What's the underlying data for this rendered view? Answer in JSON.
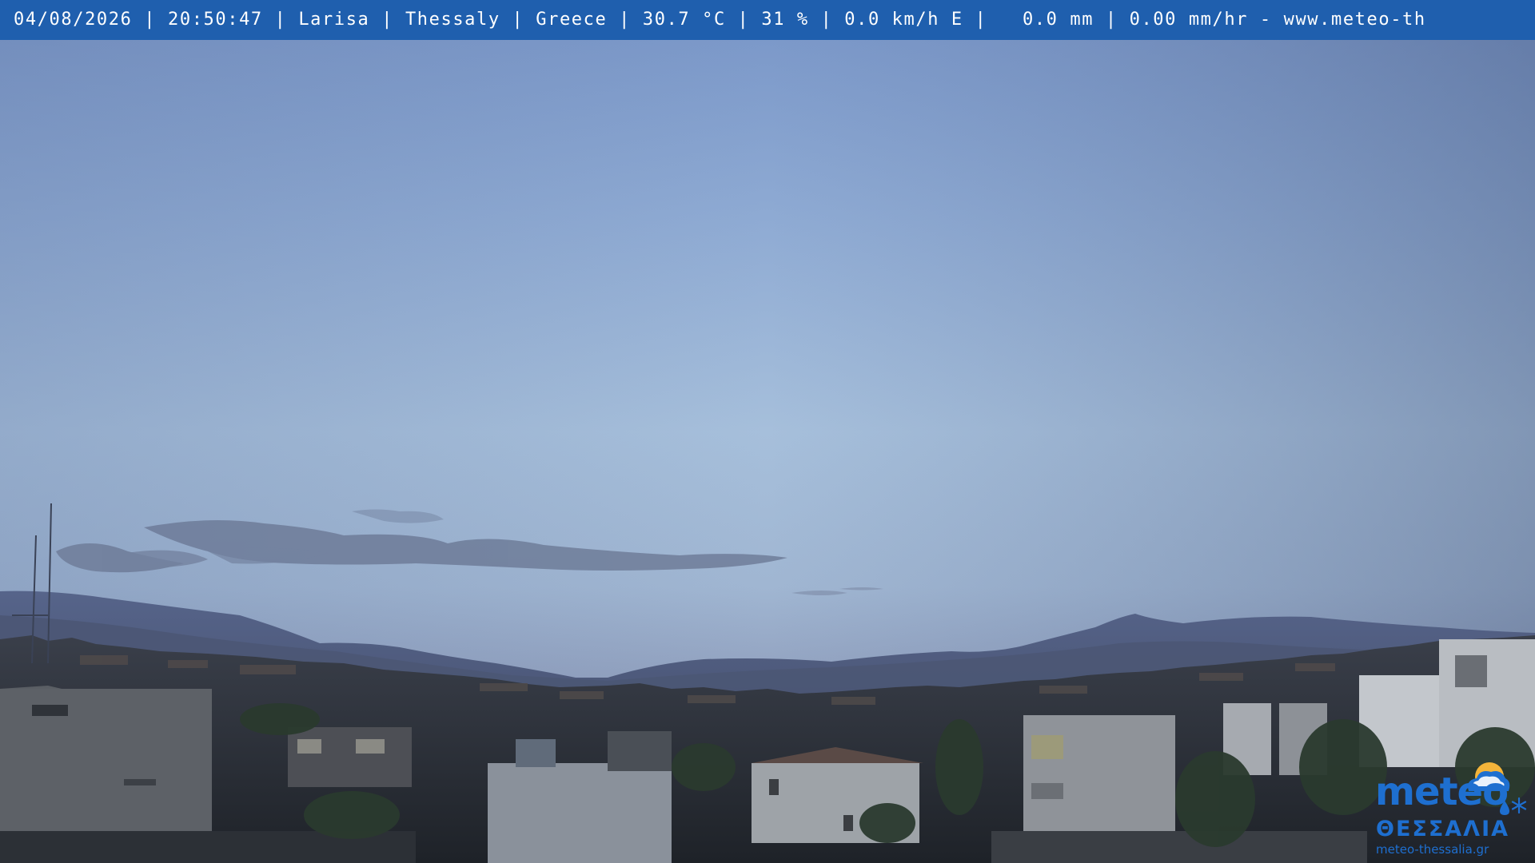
{
  "overlay": {
    "date": "04/08/2026",
    "time": "20:50:47",
    "city": "Larisa",
    "region": "Thessaly",
    "country": "Greece",
    "temperature": "30.7 °C",
    "humidity": "31 %",
    "wind": "0.0 km/h E",
    "rain_total": "0.0 mm",
    "rain_rate": "0.00 mm/hr",
    "website": "www.meteo-th"
  },
  "logo": {
    "word": "meteo",
    "greek": "ΘΕΣΣΑΛΙΑ",
    "url": "meteo-thessalia.gr"
  },
  "colors": {
    "bar": "#1f5fae",
    "bar_text": "#ffffff",
    "logo_blue": "#1e6fd0",
    "logo_sun": "#f4b43a",
    "sky_top": "#7e9ccc",
    "sky_mid": "#a9c2dc",
    "sky_horizon": "#8e9fbc"
  },
  "scene": {
    "description_icon": "webcam-city-dusk-view"
  }
}
